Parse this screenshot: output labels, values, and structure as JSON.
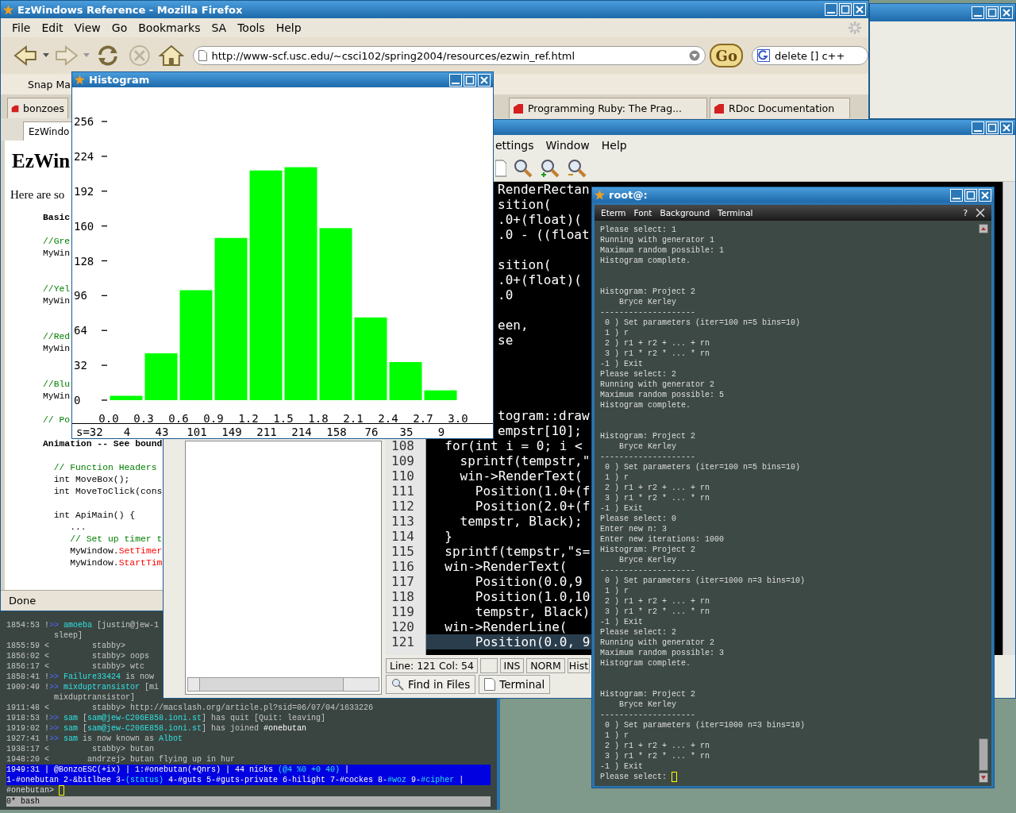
{
  "browser": {
    "title": "EzWindows Reference - Mozilla Firefox",
    "menu": [
      "File",
      "Edit",
      "View",
      "Go",
      "Bookmarks",
      "SA",
      "Tools",
      "Help"
    ],
    "url": "http://www-scf.usc.edu/~csci102/spring2004/resources/ezwin_ref.html",
    "go_label": "Go",
    "search": "delete [] c++",
    "bookmarks": [
      "Snap Ma"
    ],
    "tabs": [
      {
        "label": "bonzoes"
      },
      {
        "label": "Programming Ruby: The Prag..."
      },
      {
        "label": "RDoc Documentation"
      }
    ],
    "page_tab": "EzWindo",
    "page": [
      {
        "kind": "heading",
        "text": "EzWin"
      },
      {
        "kind": "para",
        "text": "Here are so"
      },
      {
        "kind": "code",
        "parts": [
          {
            "text": "Basic",
            "kind": "bold"
          }
        ]
      },
      {
        "kind": "blank"
      },
      {
        "kind": "code",
        "parts": [
          {
            "text": "//Gre",
            "kind": "comment"
          }
        ]
      },
      {
        "kind": "code",
        "parts": [
          {
            "text": "MyWin",
            "kind": "plain"
          }
        ]
      },
      {
        "kind": "blank"
      },
      {
        "kind": "blank"
      },
      {
        "kind": "code",
        "parts": [
          {
            "text": "//Yel",
            "kind": "comment"
          }
        ]
      },
      {
        "kind": "code",
        "parts": [
          {
            "text": "MyWin",
            "kind": "plain"
          }
        ]
      },
      {
        "kind": "blank"
      },
      {
        "kind": "blank"
      },
      {
        "kind": "code",
        "parts": [
          {
            "text": "//Red",
            "kind": "comment"
          }
        ]
      },
      {
        "kind": "code",
        "parts": [
          {
            "text": "MyWin",
            "kind": "plain"
          }
        ]
      },
      {
        "kind": "blank"
      },
      {
        "kind": "blank"
      },
      {
        "kind": "code",
        "parts": [
          {
            "text": "//Blu",
            "kind": "comment"
          }
        ]
      },
      {
        "kind": "code",
        "parts": [
          {
            "text": "MyWin",
            "kind": "plain"
          }
        ]
      },
      {
        "kind": "blank"
      },
      {
        "kind": "code",
        "parts": [
          {
            "text": "// Po",
            "kind": "comment"
          }
        ]
      },
      {
        "kind": "blank"
      },
      {
        "kind": "code",
        "parts": [
          {
            "text": "Animation -- See bound",
            "kind": "bold"
          }
        ]
      },
      {
        "kind": "blank"
      },
      {
        "kind": "code",
        "parts": [
          {
            "text": "  // Function Headers",
            "kind": "comment"
          }
        ]
      },
      {
        "kind": "code",
        "parts": [
          {
            "text": "  int MoveBox();",
            "kind": "plain"
          }
        ]
      },
      {
        "kind": "code",
        "parts": [
          {
            "text": "  int MoveToClick(cons",
            "kind": "plain"
          }
        ]
      },
      {
        "kind": "blank"
      },
      {
        "kind": "code",
        "parts": [
          {
            "text": "  int ApiMain() {",
            "kind": "plain"
          }
        ]
      },
      {
        "kind": "code",
        "parts": [
          {
            "text": "     ...",
            "kind": "plain"
          }
        ]
      },
      {
        "kind": "code",
        "parts": [
          {
            "text": "     // Set up timer t",
            "kind": "comment"
          }
        ]
      },
      {
        "kind": "code",
        "parts": [
          {
            "text": "     MyWindow.",
            "kind": "plain"
          },
          {
            "text": "SetTimer",
            "kind": "method"
          }
        ]
      },
      {
        "kind": "code",
        "parts": [
          {
            "text": "     MyWindow.",
            "kind": "plain"
          },
          {
            "text": "StartTim",
            "kind": "method"
          }
        ]
      }
    ],
    "status": "Done"
  },
  "histogram": {
    "title": "Histogram",
    "chart_data": {
      "type": "bar",
      "x": [
        0.15,
        0.45,
        0.75,
        1.05,
        1.35,
        1.65,
        1.95,
        2.25,
        2.55,
        2.85
      ],
      "values": [
        4,
        43,
        101,
        149,
        211,
        214,
        158,
        76,
        35,
        9
      ],
      "xlim": [
        0,
        3
      ],
      "ylim": [
        0,
        256
      ],
      "xticks": [
        {
          "value": 0,
          "label": "0.0"
        },
        {
          "value": 0.3,
          "label": "0.3"
        },
        {
          "value": 0.6,
          "label": "0.6"
        },
        {
          "value": 0.9,
          "label": "0.9"
        },
        {
          "value": 1.2,
          "label": "1.2"
        },
        {
          "value": 1.5,
          "label": "1.5"
        },
        {
          "value": 1.8,
          "label": "1.8"
        },
        {
          "value": 2.1,
          "label": "2.1"
        },
        {
          "value": 2.4,
          "label": "2.4"
        },
        {
          "value": 2.7,
          "label": "2.7"
        },
        {
          "value": 3.0,
          "label": "3.0"
        }
      ],
      "yticks": [
        0,
        32,
        64,
        96,
        128,
        160,
        192,
        224,
        256
      ]
    },
    "counts": [
      "s=32",
      "4",
      "43",
      "101",
      "149",
      "211",
      "214",
      "158",
      "76",
      "35",
      "9"
    ]
  },
  "editor": {
    "menu": [
      "ettings",
      "Window",
      "Help"
    ],
    "lines": [
      {
        "kind": "fragment",
        "text": "RenderRectan"
      },
      {
        "kind": "fragment",
        "text": "sition("
      },
      {
        "kind": "fragment",
        "text": ".0+(float)("
      },
      {
        "kind": "fragment",
        "text": ".0 - ((float"
      },
      {
        "kind": "blank"
      },
      {
        "kind": "fragment",
        "text": "sition("
      },
      {
        "kind": "fragment",
        "text": ".0+(float)("
      },
      {
        "kind": "fragment",
        "text": ".0"
      },
      {
        "kind": "blank"
      },
      {
        "kind": "fragment",
        "text": "een,"
      },
      {
        "kind": "fragment",
        "text": "se"
      },
      {
        "kind": "blank"
      },
      {
        "kind": "blank"
      },
      {
        "kind": "blank"
      },
      {
        "kind": "blank"
      },
      {
        "kind": "fragment",
        "text": "togram::draw"
      },
      {
        "kind": "fragment",
        "text": "empstr[10];"
      },
      {
        "kind": "numbered",
        "n": "108",
        "text": "  for(int i = 0; i <",
        "current": false
      },
      {
        "kind": "numbered",
        "n": "109",
        "text": "    sprintf(tempstr,\"",
        "current": false
      },
      {
        "kind": "numbered",
        "n": "110",
        "text": "    win->RenderText(",
        "current": false
      },
      {
        "kind": "numbered",
        "n": "111",
        "text": "      Position(1.0+(f",
        "current": false
      },
      {
        "kind": "numbered",
        "n": "112",
        "text": "      Position(2.0+(f",
        "current": false
      },
      {
        "kind": "numbered",
        "n": "113",
        "text": "    tempstr, Black);",
        "current": false
      },
      {
        "kind": "numbered",
        "n": "114",
        "text": "  }",
        "current": false
      },
      {
        "kind": "numbered",
        "n": "115",
        "text": "  sprintf(tempstr,\"s=",
        "current": false
      },
      {
        "kind": "numbered",
        "n": "116",
        "text": "  win->RenderText(",
        "current": false
      },
      {
        "kind": "numbered",
        "n": "117",
        "text": "      Position(0.0,9",
        "current": false
      },
      {
        "kind": "numbered",
        "n": "118",
        "text": "      Position(1.0,10",
        "current": false
      },
      {
        "kind": "numbered",
        "n": "119",
        "text": "      tempstr, Black)",
        "current": false
      },
      {
        "kind": "numbered",
        "n": "120",
        "text": "  win->RenderLine(",
        "current": false
      },
      {
        "kind": "numbered",
        "n": "121",
        "text": "      Position(0.0, 9",
        "current": true
      }
    ],
    "status": [
      "Line: 121 Col: 54",
      "INS",
      "NORM",
      "Hist"
    ],
    "bottom_tabs": [
      "Find in Files",
      "Terminal"
    ]
  },
  "eterm": {
    "title": "root@:",
    "menu": [
      "Eterm",
      "Font",
      "Background",
      "Terminal"
    ],
    "help": "?",
    "lines": [
      {
        "kind": "text",
        "text": "Please select: 1"
      },
      {
        "kind": "text",
        "text": "Running with generator 1"
      },
      {
        "kind": "text",
        "text": "Maximum random possible: 1"
      },
      {
        "kind": "text",
        "text": "Histogram complete."
      },
      {
        "kind": "blank"
      },
      {
        "kind": "blank"
      },
      {
        "kind": "text",
        "text": "Histogram: Project 2"
      },
      {
        "kind": "text",
        "text": "    Bryce Kerley"
      },
      {
        "kind": "text",
        "text": "--------------------"
      },
      {
        "kind": "text",
        "text": " 0 ) Set parameters (iter=100 n=5 bins=10)"
      },
      {
        "kind": "text",
        "text": " 1 ) r"
      },
      {
        "kind": "text",
        "text": " 2 ) r1 + r2 + ... + rn"
      },
      {
        "kind": "text",
        "text": " 3 ) r1 * r2 * ... * rn"
      },
      {
        "kind": "text",
        "text": "-1 ) Exit"
      },
      {
        "kind": "text",
        "text": "Please select: 2"
      },
      {
        "kind": "text",
        "text": "Running with generator 2"
      },
      {
        "kind": "text",
        "text": "Maximum random possible: 5"
      },
      {
        "kind": "text",
        "text": "Histogram complete."
      },
      {
        "kind": "blank"
      },
      {
        "kind": "blank"
      },
      {
        "kind": "text",
        "text": "Histogram: Project 2"
      },
      {
        "kind": "text",
        "text": "    Bryce Kerley"
      },
      {
        "kind": "text",
        "text": "--------------------"
      },
      {
        "kind": "text",
        "text": " 0 ) Set parameters (iter=100 n=5 bins=10)"
      },
      {
        "kind": "text",
        "text": " 1 ) r"
      },
      {
        "kind": "text",
        "text": " 2 ) r1 + r2 + ... + rn"
      },
      {
        "kind": "text",
        "text": " 3 ) r1 * r2 * ... * rn"
      },
      {
        "kind": "text",
        "text": "-1 ) Exit"
      },
      {
        "kind": "text",
        "text": "Please select: 0"
      },
      {
        "kind": "text",
        "text": "Enter new n: 3"
      },
      {
        "kind": "text",
        "text": "Enter new iterations: 1000"
      },
      {
        "kind": "text",
        "text": "Histogram: Project 2"
      },
      {
        "kind": "text",
        "text": "    Bryce Kerley"
      },
      {
        "kind": "text",
        "text": "--------------------"
      },
      {
        "kind": "text",
        "text": " 0 ) Set parameters (iter=1000 n=3 bins=10)"
      },
      {
        "kind": "text",
        "text": " 1 ) r"
      },
      {
        "kind": "text",
        "text": " 2 ) r1 + r2 + ... + rn"
      },
      {
        "kind": "text",
        "text": " 3 ) r1 * r2 * ... * rn"
      },
      {
        "kind": "text",
        "text": "-1 ) Exit"
      },
      {
        "kind": "text",
        "text": "Please select: 2"
      },
      {
        "kind": "text",
        "text": "Running with generator 2"
      },
      {
        "kind": "text",
        "text": "Maximum random possible: 3"
      },
      {
        "kind": "text",
        "text": "Histogram complete."
      },
      {
        "kind": "blank"
      },
      {
        "kind": "blank"
      },
      {
        "kind": "text",
        "text": "Histogram: Project 2"
      },
      {
        "kind": "text",
        "text": "    Bryce Kerley"
      },
      {
        "kind": "text",
        "text": "--------------------"
      },
      {
        "kind": "text",
        "text": " 0 ) Set parameters (iter=1000 n=3 bins=10)"
      },
      {
        "kind": "text",
        "text": " 1 ) r"
      },
      {
        "kind": "text",
        "text": " 2 ) r1 + r2 + ... + rn"
      },
      {
        "kind": "text",
        "text": " 3 ) r1 * r2 * ... * rn"
      },
      {
        "kind": "text",
        "text": "-1 ) Exit"
      },
      {
        "kind": "prompt",
        "text": "Please select:"
      }
    ]
  },
  "irc": {
    "lines": [
      [
        {
          "text": "1854:53 !",
          "kind": "dim"
        },
        {
          "text": ">> ",
          "kind": "blue"
        },
        {
          "text": "amoeba",
          "kind": "cyan"
        },
        {
          "text": " [justin@jew-1",
          "kind": "dim"
        }
      ],
      [
        {
          "text": "          sleep]",
          "kind": "dim"
        }
      ],
      [
        {
          "text": "1855:59 <         stabby>",
          "kind": "dim"
        }
      ],
      [
        {
          "text": "1856:02 <         stabby> oops",
          "kind": "dim"
        }
      ],
      [
        {
          "text": "1856:17 <         stabby> wtc",
          "kind": "dim"
        }
      ],
      [
        {
          "text": "1858:41 !",
          "kind": "dim"
        },
        {
          "text": ">> ",
          "kind": "blue"
        },
        {
          "text": "Failure33424",
          "kind": "cyan"
        },
        {
          "text": " is now",
          "kind": "dim"
        }
      ],
      [
        {
          "text": "1909:49 !",
          "kind": "dim"
        },
        {
          "text": ">> ",
          "kind": "blue"
        },
        {
          "text": "mixduptransistor",
          "kind": "cyan"
        },
        {
          "text": " [mi",
          "kind": "dim"
        }
      ],
      [
        {
          "text": "          mixduptransistor]",
          "kind": "dim"
        }
      ],
      [
        {
          "text": "1911:48 <         stabby> http://macslash.org/article.pl?sid=06/07/04/1633226",
          "kind": "dim"
        }
      ],
      [
        {
          "text": "1918:53 !",
          "kind": "dim"
        },
        {
          "text": ">> ",
          "kind": "blue"
        },
        {
          "text": "sam",
          "kind": "cyan"
        },
        {
          "text": " [",
          "kind": "dim"
        },
        {
          "text": "sam@jew-C206E858.ioni.st",
          "kind": "cyan"
        },
        {
          "text": "] has quit [Quit: leaving]",
          "kind": "dim"
        }
      ],
      [
        {
          "text": "1919:02 !",
          "kind": "dim"
        },
        {
          "text": ">> ",
          "kind": "blue"
        },
        {
          "text": "sam",
          "kind": "cyan"
        },
        {
          "text": " [",
          "kind": "dim"
        },
        {
          "text": "sam@jew-C206E858.ioni.st",
          "kind": "cyan"
        },
        {
          "text": "] has joined ",
          "kind": "dim"
        },
        {
          "text": "#onebutan",
          "kind": "white"
        }
      ],
      [
        {
          "text": "1927:41 !",
          "kind": "dim"
        },
        {
          "text": ">> ",
          "kind": "blue"
        },
        {
          "text": "sam",
          "kind": "cyan"
        },
        {
          "text": " is now known as ",
          "kind": "dim"
        },
        {
          "text": "Albot",
          "kind": "cyan"
        }
      ],
      [
        {
          "text": "1938:17 <         stabby> butan",
          "kind": "dim"
        }
      ],
      [
        {
          "text": "1948:20 <        andrzej> butan flying up in hur",
          "kind": "dim"
        }
      ]
    ],
    "status_lines": [
      [
        {
          "text": "1949:31 | @BonzoESC(+ix) | 1:#onebutan(+Qnrs) | 44 nicks ",
          "kind": "white"
        },
        {
          "text": "(@4 %0 +0 40)",
          "kind": "cyan"
        },
        {
          "text": " |",
          "kind": "white"
        }
      ],
      [
        {
          "text": "1-#onebutan 2-&bitlbee 3-",
          "kind": "white"
        },
        {
          "text": "(status)",
          "kind": "cyan"
        },
        {
          "text": " 4-#guts 5-#guts-private 6-hilight 7-#cockes 8-",
          "kind": "white"
        },
        {
          "text": "#woz",
          "kind": "cyan"
        },
        {
          "text": " 9-",
          "kind": "white"
        },
        {
          "text": "#cipher",
          "kind": "cyan"
        },
        {
          "text": " |",
          "kind": "white"
        }
      ]
    ],
    "prompt": "#onebutan>",
    "screen_bar": "0* bash"
  }
}
